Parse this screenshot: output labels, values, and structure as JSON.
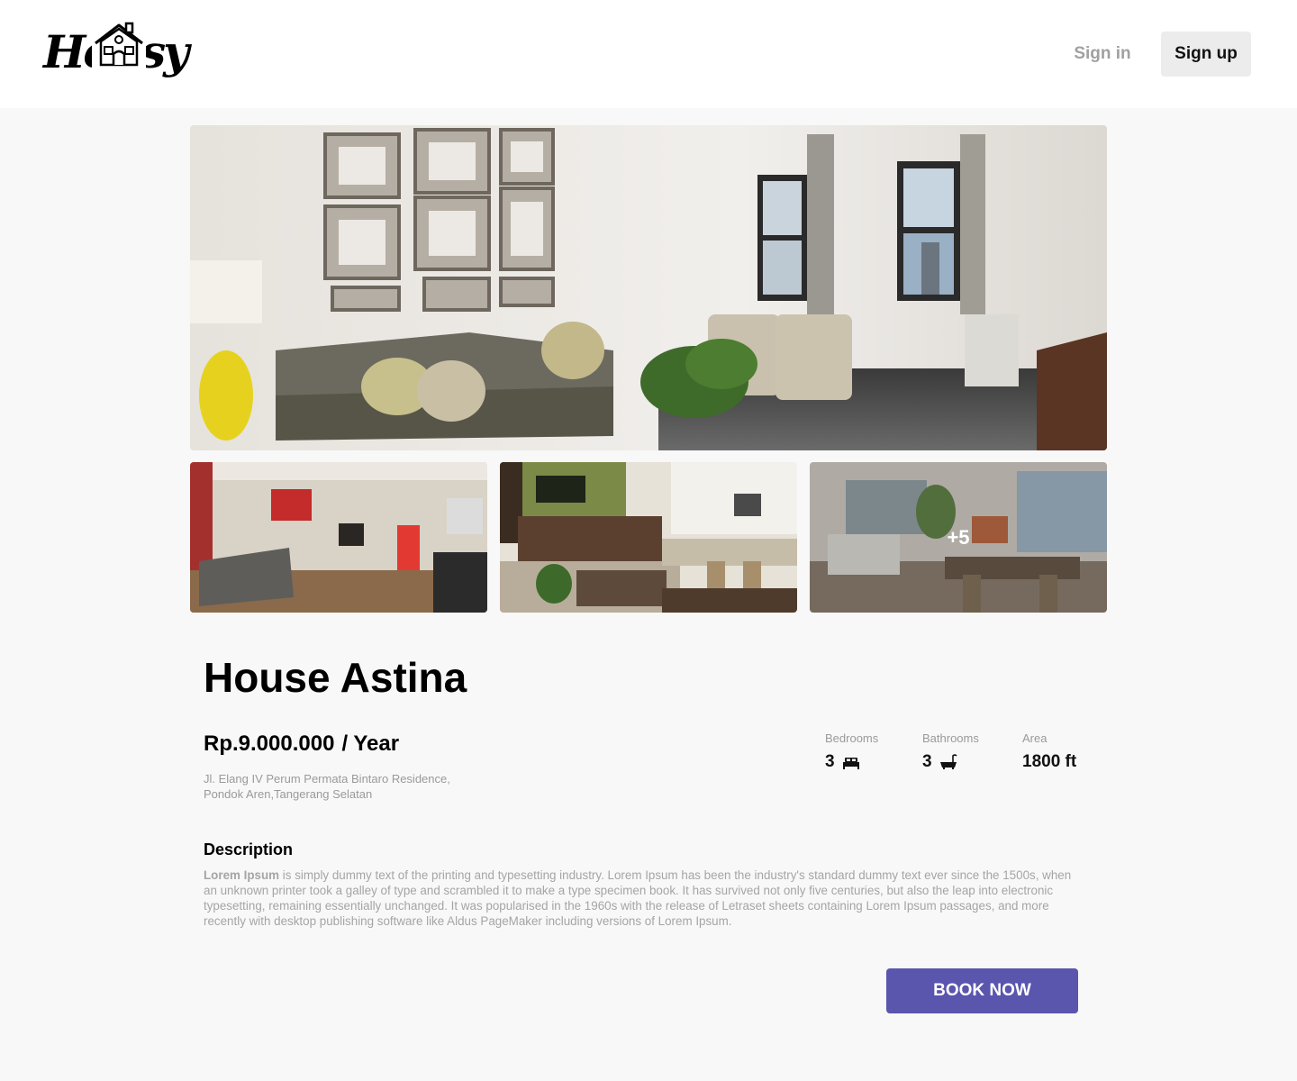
{
  "header": {
    "logo_text": "Housy",
    "signin_label": "Sign in",
    "signup_label": "Sign up"
  },
  "gallery": {
    "more_count": "+5"
  },
  "property": {
    "name": "House Astina",
    "price": "Rp.9.000.000",
    "period": "/ Year",
    "address": "Jl. Elang IV Perum Permata Bintaro Residence, Pondok Aren,Tangerang Selatan",
    "specs": {
      "bedrooms_label": "Bedrooms",
      "bedrooms_value": "3",
      "bathrooms_label": "Bathrooms",
      "bathrooms_value": "3",
      "area_label": "Area",
      "area_value": "1800 ft"
    }
  },
  "description": {
    "heading": "Description",
    "lead": "Lorem Ipsum",
    "body": " is simply dummy text of the printing and typesetting industry. Lorem Ipsum has been the industry's standard dummy text ever since the 1500s, when an unknown printer took a galley of type and scrambled it to make a type specimen book.  It has survived not only five centuries, but also the leap into electronic typesetting, remaining essentially unchanged. It was popularised in the 1960s with the release of Letraset sheets containing Lorem Ipsum passages, and more recently with desktop publishing software like Aldus PageMaker including versions of Lorem Ipsum."
  },
  "actions": {
    "book_label": "BOOK NOW"
  },
  "colors": {
    "accent": "#5a55ad",
    "page_bg": "#f8f8f8",
    "muted_text": "#9a9a9a"
  }
}
